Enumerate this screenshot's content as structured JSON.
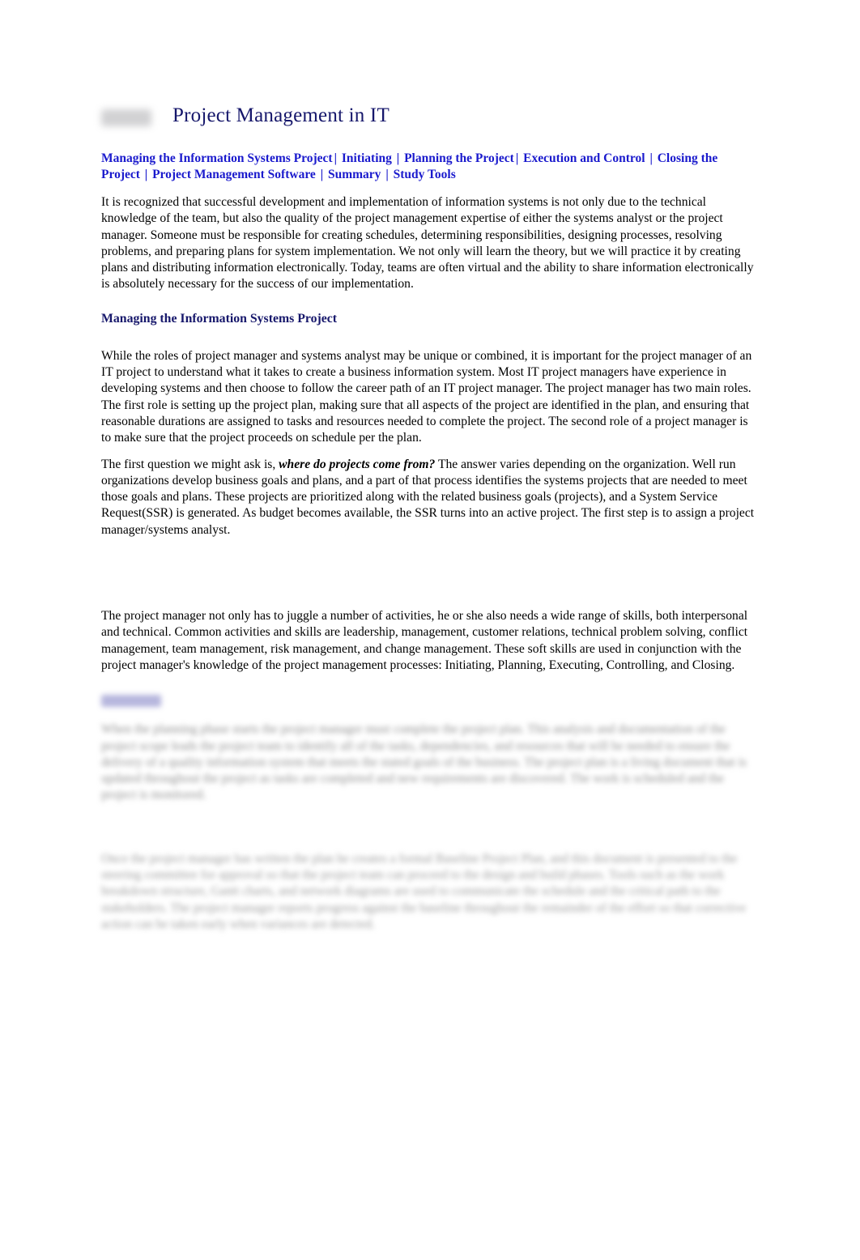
{
  "document": {
    "title": "Project Management in IT",
    "title_color": "#16176b",
    "redacted_logo_label": "redacted-logo"
  },
  "nav": {
    "separator": "|",
    "link_color": "#1a1acd",
    "items": [
      "Managing the Information Systems Project",
      "Initiating",
      "Planning the Project",
      "Execution and Control",
      "Closing the Project",
      "Project Management Software",
      "Summary",
      "Study Tools"
    ]
  },
  "body": {
    "intro": "It is recognized that successful development and implementation of information systems is not only due to the technical knowledge of the team, but also the quality of the project management expertise of either the systems analyst or the project manager. Someone must be responsible for creating schedules, determining responsibilities, designing processes, resolving problems, and preparing plans for system implementation. We not only will learn the theory, but we will practice it by creating plans and distributing information electronically. Today, teams are often virtual and the ability to share information electronically is absolutely necessary for the success of our implementation.",
    "section_heading": "Managing the Information Systems Project",
    "para_roles": "While the roles of project manager and systems analyst may be unique or combined, it is important for the project manager of an IT project to understand what it takes to create a business information system. Most IT project managers have experience in developing systems and then choose to follow the career path of an IT project manager. The project manager has two main roles. The first role is setting up the project plan, making sure that all aspects of the project are identified in the plan, and ensuring that reasonable durations are assigned to tasks and resources needed to complete the project. The second role of a project manager is to make sure that the project proceeds on schedule per the plan.",
    "para_origin_start": "The first question we might ask is, ",
    "para_origin_emphasis": "where do projects come from?",
    "para_origin_end": " The answer varies depending on the organization. Well run organizations develop business goals and plans, and a part of that process identifies the systems projects that are needed to meet those goals and plans. These projects are prioritized along with the related business goals (projects), and a System Service Request(SSR) is generated. As budget becomes available, the SSR turns into an active project. The first step is to assign a project manager/systems analyst.",
    "para_skills": "The project manager not only has to juggle a number of activities, he or she also needs a wide range of skills, both interpersonal and technical. Common activities and skills are leadership, management, customer relations, technical problem solving, conflict management, team management, risk management, and change management. These soft skills are used in conjunction with the project manager's knowledge of the project management processes: Initiating, Planning, Executing, Controlling, and Closing."
  },
  "redacted": {
    "heading_label": "blurred-section-heading",
    "block_one_label": "blurred-paragraph-one",
    "block_one_placeholder": "When the planning phase starts the project manager must complete the project plan. This analysis and documentation of the project scope leads the project team to identify all of the tasks, dependencies, and resources that will be needed to ensure the delivery of a quality information system that meets the stated goals of the business. The project plan is a living document that is updated throughout the project as tasks are completed and new requirements are discovered. The work is scheduled and the project is monitored.",
    "block_two_label": "blurred-paragraph-two",
    "block_two_placeholder": "Once the project manager has written the plan he creates a formal Baseline Project Plan, and this document is presented to the steering committee for approval so that the project team can proceed to the design and build phases. Tools such as the work breakdown structure, Gantt charts, and network diagrams are used to communicate the schedule and the critical path to the stakeholders. The project manager reports progress against the baseline throughout the remainder of the effort so that corrective action can be taken early when variances are detected."
  }
}
